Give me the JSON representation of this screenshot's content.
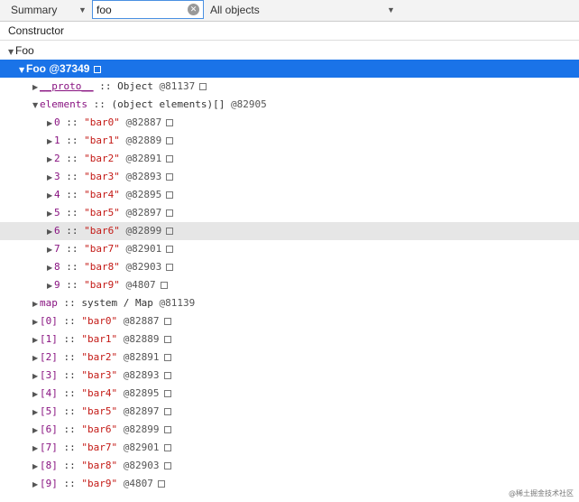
{
  "toolbar": {
    "view_select": "Summary",
    "search_value": "foo",
    "filter_select": "All objects"
  },
  "column_header": "Constructor",
  "tree": {
    "root_label": "Foo",
    "selected": {
      "name": "Foo",
      "address": "@37349"
    },
    "proto": {
      "name": "__proto__",
      "sep": " :: ",
      "type": "Object",
      "address": "@81137"
    },
    "elements": {
      "name": "elements",
      "sep": " :: ",
      "type": "(object elements)[]",
      "address": "@82905"
    },
    "element_items": [
      {
        "key": "0",
        "value": "\"bar0\"",
        "address": "@82887"
      },
      {
        "key": "1",
        "value": "\"bar1\"",
        "address": "@82889"
      },
      {
        "key": "2",
        "value": "\"bar2\"",
        "address": "@82891"
      },
      {
        "key": "3",
        "value": "\"bar3\"",
        "address": "@82893"
      },
      {
        "key": "4",
        "value": "\"bar4\"",
        "address": "@82895"
      },
      {
        "key": "5",
        "value": "\"bar5\"",
        "address": "@82897"
      },
      {
        "key": "6",
        "value": "\"bar6\"",
        "address": "@82899"
      },
      {
        "key": "7",
        "value": "\"bar7\"",
        "address": "@82901"
      },
      {
        "key": "8",
        "value": "\"bar8\"",
        "address": "@82903"
      },
      {
        "key": "9",
        "value": "\"bar9\"",
        "address": "@4807"
      }
    ],
    "map": {
      "name": "map",
      "sep": " :: ",
      "type": "system / Map",
      "address": "@81139"
    },
    "indexed_items": [
      {
        "key": "[0]",
        "value": "\"bar0\"",
        "address": "@82887"
      },
      {
        "key": "[1]",
        "value": "\"bar1\"",
        "address": "@82889"
      },
      {
        "key": "[2]",
        "value": "\"bar2\"",
        "address": "@82891"
      },
      {
        "key": "[3]",
        "value": "\"bar3\"",
        "address": "@82893"
      },
      {
        "key": "[4]",
        "value": "\"bar4\"",
        "address": "@82895"
      },
      {
        "key": "[5]",
        "value": "\"bar5\"",
        "address": "@82897"
      },
      {
        "key": "[6]",
        "value": "\"bar6\"",
        "address": "@82899"
      },
      {
        "key": "[7]",
        "value": "\"bar7\"",
        "address": "@82901"
      },
      {
        "key": "[8]",
        "value": "\"bar8\"",
        "address": "@82903"
      },
      {
        "key": "[9]",
        "value": "\"bar9\"",
        "address": "@4807"
      }
    ]
  },
  "watermark": "@稀土掘金技术社区",
  "colors": {
    "selection": "#1a73e8",
    "hover_row": "#e6e6e6",
    "property_name": "#881280",
    "string_value": "#c41a16",
    "search_border": "#4a90e2"
  },
  "icons": {
    "expanded": "triangle-down-icon",
    "collapsed": "triangle-right-icon",
    "clear": "clear-search-icon",
    "dropdown": "dropdown-arrow-icon",
    "reveal": "reveal-box-icon"
  }
}
